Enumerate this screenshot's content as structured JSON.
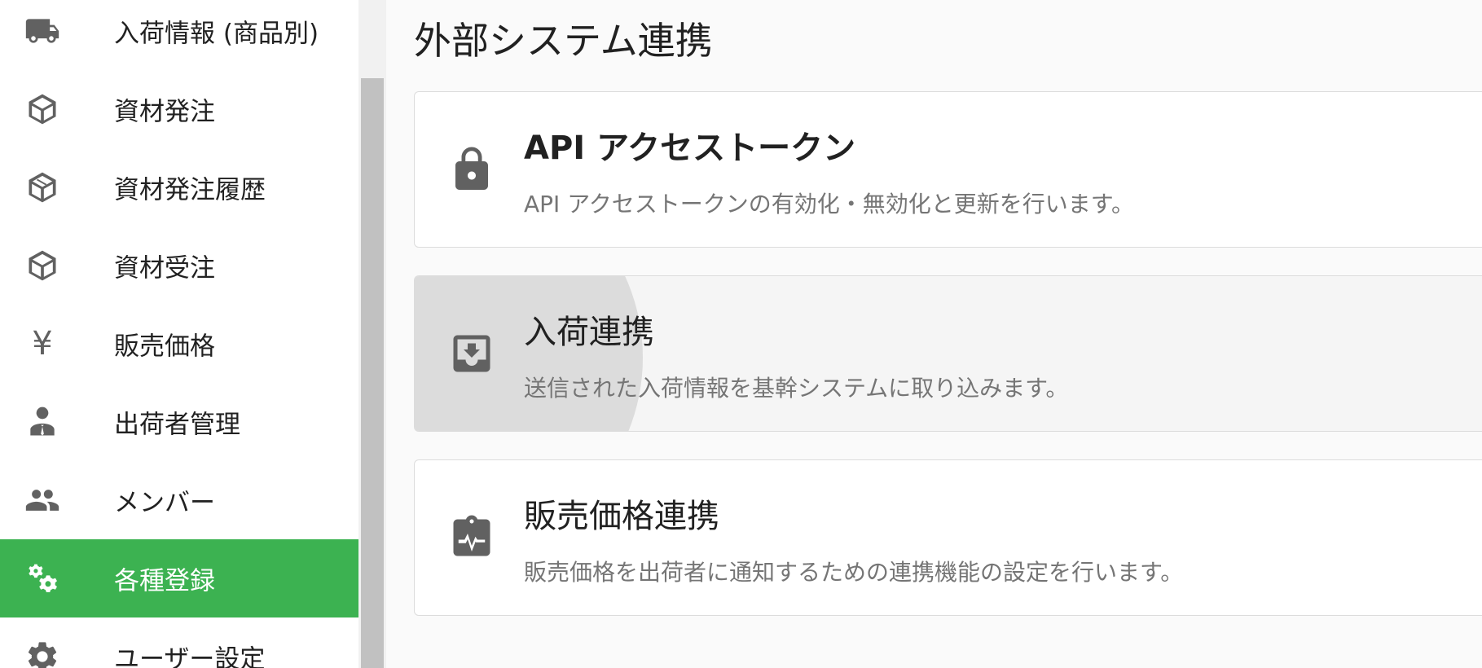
{
  "sidebar": {
    "items": [
      {
        "label": "入荷情報 (商品別)",
        "icon": "truck-icon"
      },
      {
        "label": "資材発注",
        "icon": "cube-icon"
      },
      {
        "label": "資材発注履歴",
        "icon": "cube-history-icon"
      },
      {
        "label": "資材受注",
        "icon": "cube-icon"
      },
      {
        "label": "販売価格",
        "icon": "yen-icon",
        "glyph": "¥"
      },
      {
        "label": "出荷者管理",
        "icon": "person-tie-icon"
      },
      {
        "label": "メンバー",
        "icon": "people-icon"
      },
      {
        "label": "各種登録",
        "icon": "gears-icon",
        "active": true
      },
      {
        "label": "ユーザー設定",
        "icon": "gear-icon"
      }
    ],
    "active_color": "#3cb251"
  },
  "main": {
    "title": "外部システム連携",
    "cards": [
      {
        "title": "API アクセストークン",
        "description": "API アクセストークンの有効化・無効化と更新を行います。",
        "icon": "lock-icon"
      },
      {
        "title": "入荷連携",
        "description": "送信された入荷情報を基幹システムに取り込みます。",
        "icon": "inbox-download-icon"
      },
      {
        "title": "販売価格連携",
        "description": "販売価格を出荷者に通知するための連携機能の設定を行います。",
        "icon": "clipboard-pulse-icon"
      }
    ]
  }
}
